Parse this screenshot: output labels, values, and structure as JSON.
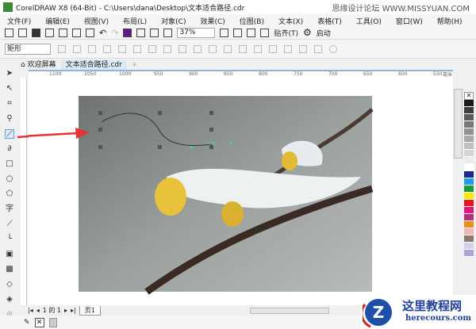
{
  "window": {
    "title": "CorelDRAW X8 (64-Bit) - C:\\Users\\dana\\Desktop\\文本适合路径.cdr"
  },
  "watermark_top": "思缘设计论坛 WWW.MISSYUAN.COM",
  "menu": [
    "文件(F)",
    "编辑(E)",
    "视图(V)",
    "布局(L)",
    "对象(C)",
    "效果(C)",
    "位图(B)",
    "文本(X)",
    "表格(T)",
    "工具(O)",
    "窗口(W)",
    "帮助(H)"
  ],
  "toolbar": {
    "zoom": "37%",
    "snap": "贴齐(T)",
    "launch": "启动"
  },
  "property_bar": {
    "shape": "矩形"
  },
  "tabs": {
    "welcome": "欢迎屏幕",
    "doc": "文本适合路径.cdr"
  },
  "ruler": {
    "ticks": [
      "1100",
      "1050",
      "1000",
      "950",
      "900",
      "850",
      "800",
      "750",
      "700",
      "650",
      "600",
      "550"
    ],
    "unit": "毫米"
  },
  "page_nav": {
    "pages": "1 的 1",
    "tab": "页1"
  },
  "palette": [
    "#1a1a1a",
    "#3d3d3d",
    "#5a5a5a",
    "#777",
    "#919191",
    "#aaa",
    "#c0c0c0",
    "#d6d6d6",
    "#ebebeb",
    "#fff",
    "#1b2a8c",
    "#1ea0e6",
    "#1a9a3a",
    "#ffe800",
    "#e8141e",
    "#e6157e",
    "#b0307e",
    "#f08c1e",
    "#f0b8b0",
    "#8c7a6e",
    "#d2d2ea",
    "#a8a8d8"
  ],
  "watermark": {
    "cn": "这里教程网",
    "en": "herecours.com"
  }
}
